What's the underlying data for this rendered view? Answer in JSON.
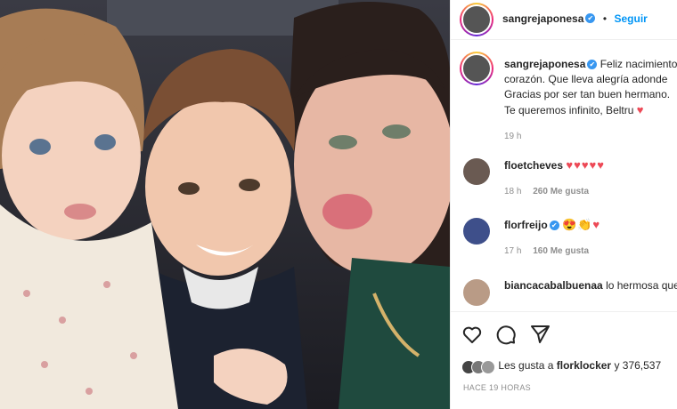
{
  "post": {
    "author": "sangrejaponesa",
    "follow_label": "Seguir",
    "verified_mark": "✔",
    "caption_lines": [
      "Feliz nacimiento",
      "corazón. Que lleva alegría adonde",
      "Gracias por ser tan buen hermano.",
      "Te queremos infinito, Beltru"
    ],
    "caption_emoji": "♥",
    "caption_time": "19 h",
    "likes_text_prefix": "Les gusta a",
    "likes_user": "florklocker",
    "likes_suffix": "y 376,537",
    "posted_ago": "HACE 19 HORAS"
  },
  "comments": [
    {
      "user": "floetcheves",
      "verified": false,
      "text": "♥♥♥♥♥",
      "time": "18 h",
      "likes": "260 Me gusta"
    },
    {
      "user": "florfreijo",
      "verified": true,
      "text": "😍👏♥",
      "time": "17 h",
      "likes": "160 Me gusta"
    },
    {
      "user": "biancacabalbuenaa",
      "verified": false,
      "text": "lo hermosa que e",
      "time": "",
      "likes": ""
    }
  ],
  "icons": [
    "heart-icon",
    "comment-icon",
    "share-icon",
    "verified-icon"
  ],
  "colors": {
    "accent": "#0095f6",
    "heart": "#ed4956",
    "verified": "#3897f0",
    "muted": "#8e8e8e"
  }
}
